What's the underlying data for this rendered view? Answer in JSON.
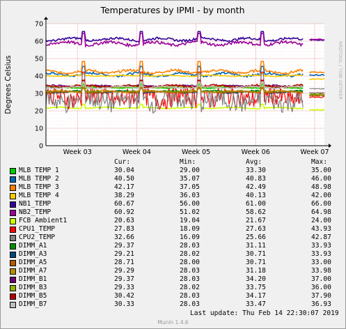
{
  "chart_data": {
    "type": "line",
    "title": "Temperatures by IPMI - by month",
    "ylabel": "Degrees Celsius",
    "watermark": "RRDTOOL / TOBI OETIKER",
    "ylim": [
      0,
      70
    ],
    "yticks": [
      "0",
      "10",
      "20",
      "30",
      "40",
      "50",
      "60",
      "70"
    ],
    "xtick_labels": [
      "Week 03",
      "Week 04",
      "Week 05",
      "Week 06",
      "Week 07"
    ],
    "columns": {
      "cur": "Cur:",
      "min": "Min:",
      "avg": "Avg:",
      "max": "Max:"
    },
    "series": [
      {
        "name": "MLB TEMP 1",
        "color": "#00cc00",
        "cur": "30.04",
        "min": "29.00",
        "avg": "33.30",
        "max": "35.00"
      },
      {
        "name": "MLB TEMP 2",
        "color": "#0066b3",
        "cur": "40.50",
        "min": "35.07",
        "avg": "40.83",
        "max": "46.00"
      },
      {
        "name": "MLB TEMP 3",
        "color": "#ff8000",
        "cur": "42.17",
        "min": "37.05",
        "avg": "42.49",
        "max": "48.98"
      },
      {
        "name": "MLB TEMP 4",
        "color": "#ffcc00",
        "cur": "38.29",
        "min": "36.03",
        "avg": "40.13",
        "max": "42.00"
      },
      {
        "name": "NB1_TEMP",
        "color": "#330099",
        "cur": "60.67",
        "min": "56.00",
        "avg": "61.00",
        "max": "66.00"
      },
      {
        "name": "NB2_TEMP",
        "color": "#990099",
        "cur": "60.92",
        "min": "51.02",
        "avg": "58.62",
        "max": "64.98"
      },
      {
        "name": "FCB Ambient1",
        "color": "#ccff00",
        "cur": "20.63",
        "min": "19.04",
        "avg": "21.67",
        "max": "24.00"
      },
      {
        "name": "CPU1_TEMP",
        "color": "#ff0000",
        "cur": "27.83",
        "min": "18.09",
        "avg": "27.63",
        "max": "43.93"
      },
      {
        "name": "CPU2_TEMP",
        "color": "#808080",
        "cur": "32.66",
        "min": "16.09",
        "avg": "25.66",
        "max": "42.87"
      },
      {
        "name": "DIMM_A1",
        "color": "#008f00",
        "cur": "29.37",
        "min": "28.03",
        "avg": "31.11",
        "max": "33.93"
      },
      {
        "name": "DIMM_A3",
        "color": "#00487d",
        "cur": "29.21",
        "min": "28.02",
        "avg": "30.71",
        "max": "33.93"
      },
      {
        "name": "DIMM_A5",
        "color": "#b35a00",
        "cur": "28.71",
        "min": "28.00",
        "avg": "30.71",
        "max": "33.00"
      },
      {
        "name": "DIMM_A7",
        "color": "#b38f00",
        "cur": "29.29",
        "min": "28.03",
        "avg": "31.18",
        "max": "33.98"
      },
      {
        "name": "DIMM_B1",
        "color": "#6b006b",
        "cur": "29.37",
        "min": "28.03",
        "avg": "34.20",
        "max": "37.00"
      },
      {
        "name": "DIMM_B3",
        "color": "#8fb300",
        "cur": "29.33",
        "min": "28.02",
        "avg": "33.75",
        "max": "36.00"
      },
      {
        "name": "DIMM_B5",
        "color": "#b30000",
        "cur": "30.42",
        "min": "28.03",
        "avg": "34.17",
        "max": "37.90"
      },
      {
        "name": "DIMM_B7",
        "color": "#bebebe",
        "cur": "30.33",
        "min": "28.03",
        "avg": "33.47",
        "max": "36.93"
      }
    ]
  },
  "footer": {
    "last_update": "Last update:  Thu Feb 14 22:30:07 2019",
    "generator": "Munin 1.4.6"
  }
}
